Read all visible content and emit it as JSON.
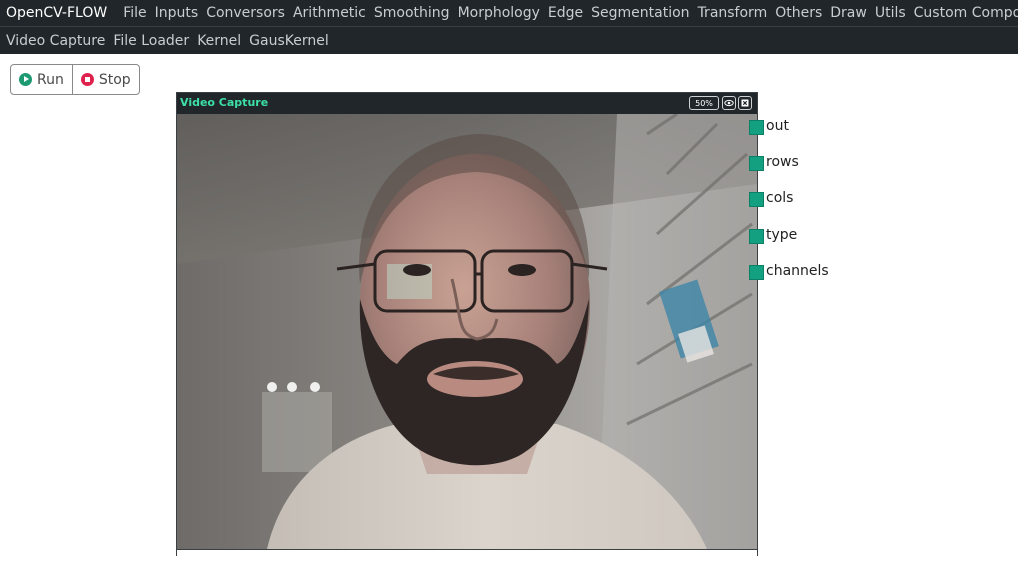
{
  "app": {
    "title": "OpenCV-FLOW"
  },
  "menu": {
    "items": [
      "File",
      "Inputs",
      "Conversors",
      "Arithmetic",
      "Smoothing",
      "Morphology",
      "Edge",
      "Segmentation",
      "Transform",
      "Others",
      "Draw",
      "Utils",
      "Custom Components"
    ]
  },
  "toolbar": {
    "items": [
      "Video Capture",
      "File Loader",
      "Kernel",
      "GausKernel"
    ]
  },
  "controls": {
    "run_label": "Run",
    "stop_label": "Stop"
  },
  "node": {
    "title": "Video Capture",
    "zoom": "50%",
    "outputs": [
      "out",
      "rows",
      "cols",
      "type",
      "channels"
    ]
  },
  "colors": {
    "accent": "#3ce0a6",
    "port": "#12a080",
    "run": "#1e9a72",
    "stop": "#e0204d",
    "bar": "#20262a"
  }
}
